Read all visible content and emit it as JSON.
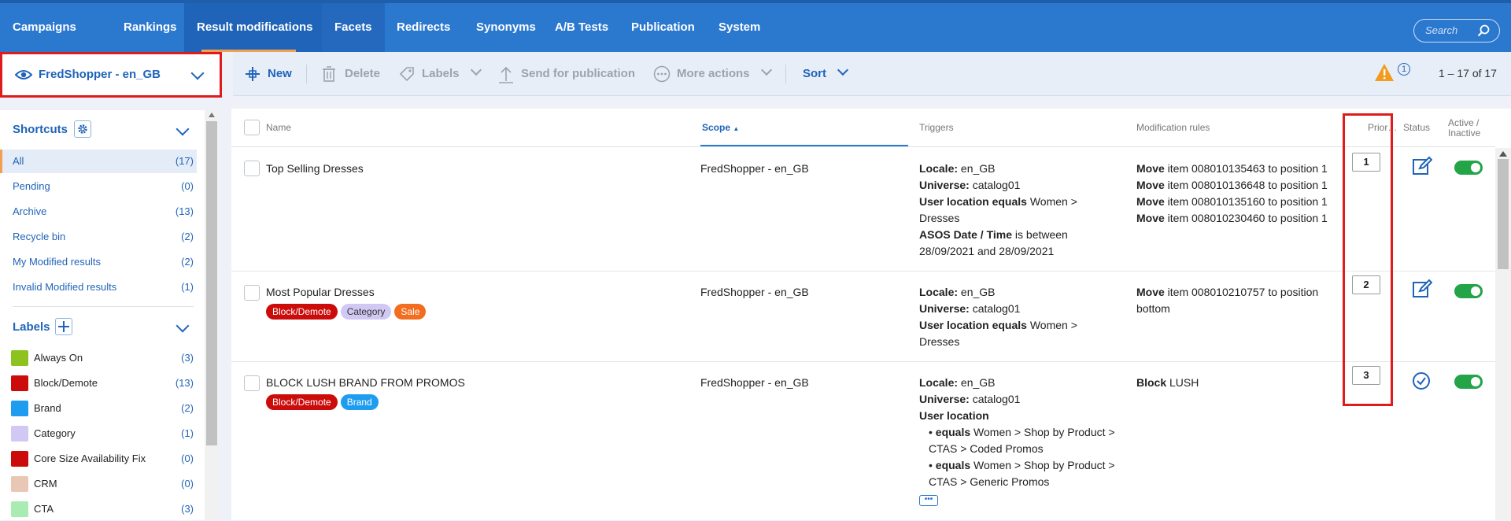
{
  "nav": {
    "items": [
      {
        "label": "Campaigns"
      },
      {
        "label": "Rankings"
      },
      {
        "label": "Result modifications"
      },
      {
        "label": "Facets"
      },
      {
        "label": "Redirects"
      },
      {
        "label": "Synonyms"
      },
      {
        "label": "A/B Tests"
      },
      {
        "label": "Publication"
      },
      {
        "label": "System"
      }
    ],
    "search_placeholder": "Search"
  },
  "scope_selector": {
    "label": "FredShopper - en_GB"
  },
  "toolbar": {
    "new": "New",
    "delete": "Delete",
    "labels": "Labels",
    "send": "Send for publication",
    "more": "More actions",
    "sort": "Sort",
    "notification_count": "1",
    "pager": "1 – 17 of 17"
  },
  "sidebar": {
    "shortcuts_title": "Shortcuts",
    "shortcuts": [
      {
        "label": "All",
        "count": "(17)"
      },
      {
        "label": "Pending",
        "count": "(0)"
      },
      {
        "label": "Archive",
        "count": "(13)"
      },
      {
        "label": "Recycle bin",
        "count": "(2)"
      },
      {
        "label": "My Modified results",
        "count": "(2)"
      },
      {
        "label": "Invalid Modified results",
        "count": "(1)"
      }
    ],
    "labels_title": "Labels",
    "labels": [
      {
        "label": "Always On",
        "count": "(3)",
        "color": "#8dc21f"
      },
      {
        "label": "Block/Demote",
        "count": "(13)",
        "color": "#cc0b0b"
      },
      {
        "label": "Brand",
        "count": "(2)",
        "color": "#1e9cef"
      },
      {
        "label": "Category",
        "count": "(1)",
        "color": "#d2c8f4"
      },
      {
        "label": "Core Size Availability Fix",
        "count": "(0)",
        "color": "#cc0b0b"
      },
      {
        "label": "CRM",
        "count": "(0)",
        "color": "#e8c8b4"
      },
      {
        "label": "CTA",
        "count": "(3)",
        "color": "#a8ecb4"
      }
    ]
  },
  "table": {
    "headers": {
      "name": "Name",
      "scope": "Scope",
      "triggers": "Triggers",
      "rules": "Modification rules",
      "priority": "Prior…",
      "status": "Status",
      "active_1": "Active /",
      "active_2": "Inactive"
    },
    "rows": [
      {
        "name": "Top Selling Dresses",
        "scope": "FredShopper - en_GB",
        "priority": "1",
        "t": {
          "locale_k": "Locale:",
          "locale_v": " en_GB",
          "universe_k": "Universe:",
          "universe_v": " catalog01",
          "loc_k": "User location equals",
          "loc_v": " Women >",
          "loc_v2": "Dresses",
          "date_k": "ASOS Date / Time",
          "date_v": " is between",
          "date_v2": "28/09/2021 and 28/09/2021"
        },
        "rules": [
          {
            "k": "Move",
            "v": " item 008010135463 to position 1"
          },
          {
            "k": "Move",
            "v": " item 008010136648 to position 1"
          },
          {
            "k": "Move",
            "v": " item 008010135160 to position 1"
          },
          {
            "k": "Move",
            "v": " item 008010230460 to position 1"
          }
        ]
      },
      {
        "name": "Most Popular Dresses",
        "scope": "FredShopper - en_GB",
        "priority": "2",
        "tags": [
          {
            "label": "Block/Demote",
            "bg": "#cc0b0b",
            "fg": "#ffffff"
          },
          {
            "label": "Category",
            "bg": "#d2c8f4",
            "fg": "#333333"
          },
          {
            "label": "Sale",
            "bg": "#f26d1f",
            "fg": "#ffffff"
          }
        ],
        "t": {
          "locale_k": "Locale:",
          "locale_v": " en_GB",
          "universe_k": "Universe:",
          "universe_v": " catalog01",
          "loc_k": "User location equals",
          "loc_v": " Women >",
          "loc_v2": "Dresses"
        },
        "rules": [
          {
            "k": "Move",
            "v": " item 008010210757 to position"
          },
          {
            "k": "",
            "v": "bottom"
          }
        ]
      },
      {
        "name": "BLOCK LUSH BRAND FROM PROMOS",
        "scope": "FredShopper - en_GB",
        "priority": "3",
        "tags": [
          {
            "label": "Block/Demote",
            "bg": "#cc0b0b",
            "fg": "#ffffff"
          },
          {
            "label": "Brand",
            "bg": "#1e9cef",
            "fg": "#ffffff"
          }
        ],
        "t": {
          "locale_k": "Locale:",
          "locale_v": " en_GB",
          "universe_k": "Universe:",
          "universe_v": " catalog01",
          "loc_k": "User location",
          "b1_k": "equals",
          "b1_v": " Women > Shop by Product >",
          "b1_v2": "CTAS > Coded Promos",
          "b2_k": "equals",
          "b2_v": " Women > Shop by Product >",
          "b2_v2": "CTAS > Generic Promos",
          "more": "•••"
        },
        "rules": [
          {
            "k": "Block",
            "v": " LUSH"
          }
        ]
      }
    ]
  }
}
